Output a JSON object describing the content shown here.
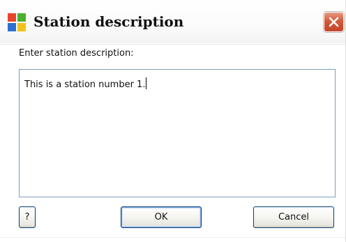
{
  "window": {
    "title": "Station description",
    "app_icon": "four-color-app-icon",
    "close_icon": "close-icon",
    "close_color": "#c84a2e"
  },
  "form": {
    "prompt_label": "Enter station description:",
    "description_value": "This is a station number 1."
  },
  "buttons": {
    "help_label": "?",
    "ok_label": "OK",
    "cancel_label": "Cancel"
  }
}
